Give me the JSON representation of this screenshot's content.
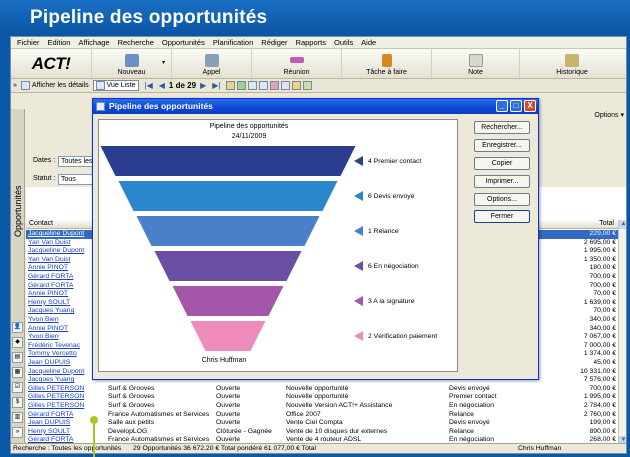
{
  "banner": {
    "title": "Pipeline des opportunités"
  },
  "menu": [
    "Fichier",
    "Edition",
    "Affichage",
    "Recherche",
    "Opportunités",
    "Planification",
    "Rédiger",
    "Rapports",
    "Outils",
    "Aide"
  ],
  "toolbar": {
    "logo": "ACT!",
    "buttons": [
      {
        "label": "Nouveau",
        "icon": "new-document-icon",
        "color": "#6b8fc9"
      },
      {
        "label": "Appel",
        "icon": "phone-icon",
        "color": "#8aa0b8"
      },
      {
        "label": "Réunion",
        "icon": "meeting-icon",
        "color": "#c45bb0"
      },
      {
        "label": "Tâche à faire",
        "icon": "task-icon",
        "color": "#d6891e"
      },
      {
        "label": "Note",
        "icon": "note-icon",
        "color": "#d7d7cf"
      },
      {
        "label": "Historique",
        "icon": "history-icon",
        "color": "#c9b26a"
      }
    ]
  },
  "navbar": {
    "details": "Afficher les détails",
    "list": "Vue Liste",
    "record": "1 de 29"
  },
  "sidebar": {
    "tab_label": "Opportunités"
  },
  "filters": {
    "dates_label": "Dates :",
    "dates_value": "Toutes les da",
    "status_label": "Statut :",
    "status_value": "Tous",
    "options_label": "Options"
  },
  "grid": {
    "headers": {
      "contact": "Contact",
      "total": "Total"
    },
    "rows": [
      [
        "Jacqueline Dupont",
        "",
        "",
        "",
        "",
        "229,00 €"
      ],
      [
        "Yan Van Duist",
        "",
        "",
        "",
        "",
        "2 695,00 €"
      ],
      [
        "Jacqueline Dupont",
        "",
        "",
        "",
        "",
        "1 995,00 €"
      ],
      [
        "Yan Van Duist",
        "",
        "",
        "",
        "",
        "1 350,00 €"
      ],
      [
        "Annie PINOT",
        "",
        "",
        "",
        "",
        "180,00 €"
      ],
      [
        "Gérard FORTA",
        "",
        "",
        "",
        "",
        "700,00 €"
      ],
      [
        "Gérard FORTA",
        "",
        "",
        "",
        "",
        "700,00 €"
      ],
      [
        "Annie PINOT",
        "",
        "",
        "",
        "",
        "70,00 €"
      ],
      [
        "Henry SOULT",
        "",
        "",
        "",
        "",
        "1 639,00 €"
      ],
      [
        "Jacques Yuang",
        "",
        "",
        "",
        "",
        "70,00 €"
      ],
      [
        "Yvon Bien",
        "",
        "",
        "",
        "",
        "340,00 €"
      ],
      [
        "Annie PINOT",
        "",
        "",
        "",
        "",
        "340,00 €"
      ],
      [
        "Yvon Bien",
        "",
        "",
        "",
        "",
        "7 067,00 €"
      ],
      [
        "Frédéric Tevenac",
        "",
        "",
        "",
        "",
        "7 000,00 €"
      ],
      [
        "Tommy Vercetto",
        "",
        "",
        "",
        "",
        "1 374,00 €"
      ],
      [
        "Jean DUPUIS",
        "",
        "",
        "",
        "",
        "45,00 €"
      ],
      [
        "Jacqueline Dupont",
        "",
        "",
        "",
        "",
        "10 331,00 €"
      ],
      [
        "Jacques Yuang",
        "",
        "",
        "",
        "",
        "7 576,00 €"
      ],
      [
        "Gilles PETERSON",
        "Surf & Grooves",
        "Ouverte",
        "Nouvelle opportunité",
        "Devis envoyé",
        "700,00 €"
      ],
      [
        "Gilles PETERSON",
        "Surf & Grooves",
        "Ouverte",
        "Nouvelle opportunité",
        "Premier contact",
        "1 995,00 €"
      ],
      [
        "Gilles PETERSON",
        "Surf & Grooves",
        "Ouverte",
        "Nouvelle Version ACT!+ Assistance",
        "En négociation",
        "2 784,00 €"
      ],
      [
        "Gérard FORTA",
        "France Automatismes et Services",
        "Ouverte",
        "Office 2007",
        "Relance",
        "2 760,00 €"
      ],
      [
        "Jean DUPUIS",
        "Salle aux petits",
        "Ouverte",
        "Vente Ciel Compta",
        "Devis envoyé",
        "199,00 €"
      ],
      [
        "Henry SOULT",
        "DevelopLOG",
        "Clôturée - Gagnée",
        "Vente de 10 disques dur externes",
        "Relance",
        "890,00 €"
      ],
      [
        "Gérard FORTA",
        "France Automatismes et Services",
        "Ouverte",
        "Vente de 4 routeur ADSL",
        "En négociation",
        "268,00 €"
      ]
    ]
  },
  "status": {
    "left": "Recherche : Toutes les opportunités",
    "middle": "29 Opportunités   36 672,20 € Total pondéré   61 077,00 € Total",
    "right": "Chris Huffman"
  },
  "dialog": {
    "title": "Pipeline des opportunités",
    "buttons": [
      "Rechercher...",
      "Enregistrer...",
      "Copier",
      "Imprimer...",
      "Options...",
      "Fermer"
    ],
    "win_min": "_",
    "win_max": "□",
    "win_close": "X"
  },
  "chart_data": {
    "type": "funnel",
    "title": "Pipeline des opportunités",
    "subtitle": "24/11/2009",
    "footer": "Chris Huffman",
    "stages": [
      {
        "name": "4 Premier contact",
        "color": "#2a3d8f"
      },
      {
        "name": "6 Devis envoyé",
        "color": "#2b87cc"
      },
      {
        "name": "1 Relance",
        "color": "#4a7fc9"
      },
      {
        "name": "6 En négociation",
        "color": "#6a4fa3"
      },
      {
        "name": "3 A la signature",
        "color": "#a457a8"
      },
      {
        "name": "2 Vérification paiement",
        "color": "#ee8cbe"
      }
    ]
  }
}
